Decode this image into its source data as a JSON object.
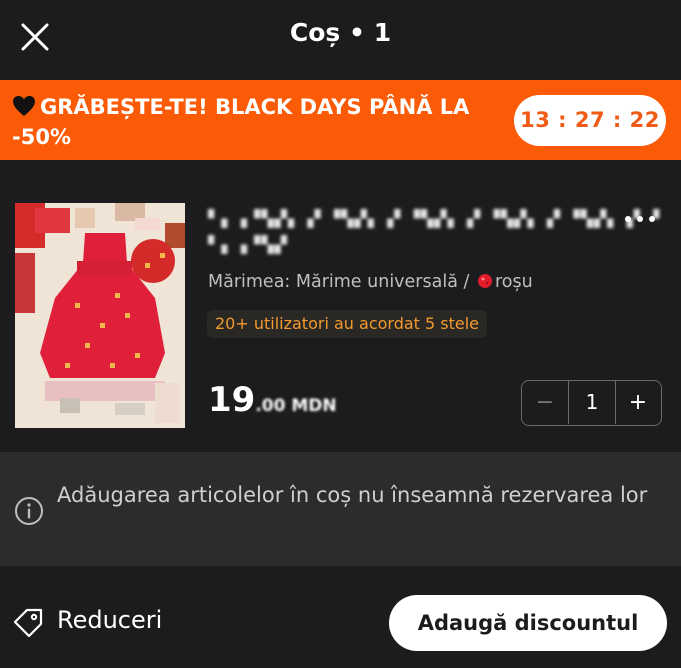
{
  "header": {
    "title": "Coș • 1",
    "close_icon": "close-icon"
  },
  "promo": {
    "icon": "black-heart-icon",
    "text": "GRĂBEȘTE-TE! BLACK DAYS PÂNĂ LA -50%",
    "countdown": "13 : 27 : 22",
    "background": "#fb5a06",
    "timer_color": "#f05a14"
  },
  "item": {
    "title": "▘▖▗▝▚▞▖▗▘▝▚▞▖▗▘▝▚▞▖▗▘▝▚▞▖▗▘▝▚▞▖▗▘▝ ▘▖▗▝▚▞",
    "size_text": "Mărimea: Mărime universală /",
    "color_label": "roșu",
    "color_hex": "#e01c2c",
    "rating_text": "20+ utilizatori au acordat 5 stele",
    "price_main": "19",
    "price_rest": ".00 MDN",
    "quantity": "1",
    "minus_label": "−",
    "plus_label": "+",
    "more_icon": "more-dots-icon"
  },
  "notice": {
    "icon": "info-icon",
    "text": "Adăugarea articolelor în coș nu înseamnă rezervarea lor"
  },
  "footer": {
    "icon": "tag-icon",
    "label": "Reduceri",
    "button_label": "Adaugă discountul"
  }
}
